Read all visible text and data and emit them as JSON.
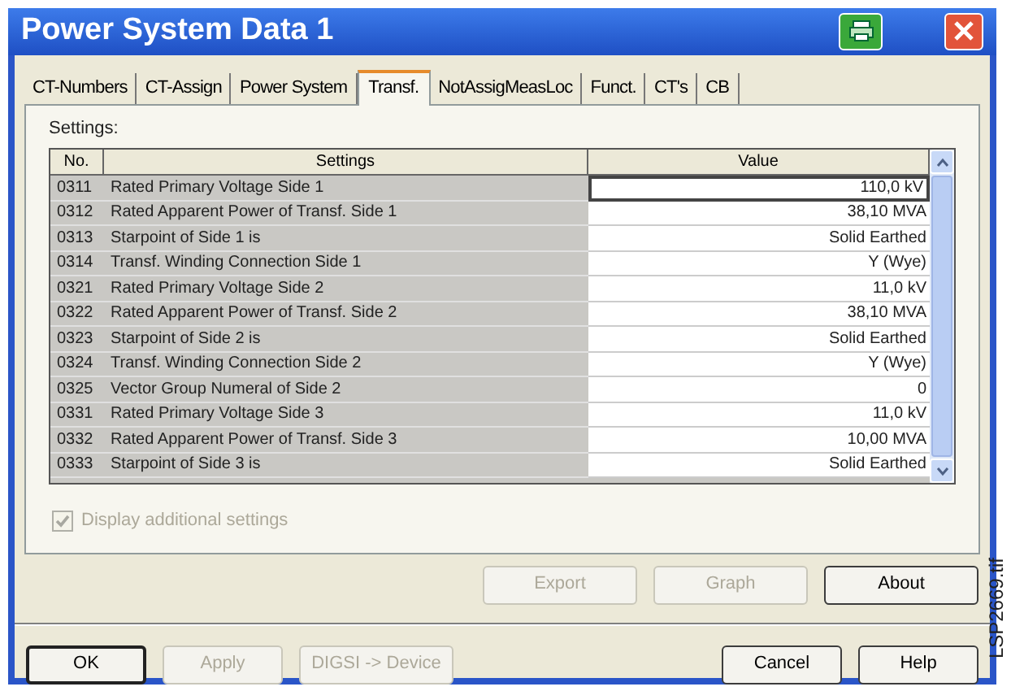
{
  "window": {
    "title": "Power System Data 1"
  },
  "tabs": [
    {
      "label": "CT-Numbers",
      "selected": false
    },
    {
      "label": "CT-Assign",
      "selected": false
    },
    {
      "label": "Power System",
      "selected": false
    },
    {
      "label": "Transf.",
      "selected": true
    },
    {
      "label": "NotAssigMeasLoc",
      "selected": false
    },
    {
      "label": "Funct.",
      "selected": false
    },
    {
      "label": "CT's",
      "selected": false
    },
    {
      "label": "CB",
      "selected": false
    }
  ],
  "settings_label": "Settings:",
  "table": {
    "columns": [
      "No.",
      "Settings",
      "Value"
    ],
    "rows": [
      {
        "no": "0311",
        "setting": "Rated Primary Voltage Side 1",
        "value": "110,0 kV",
        "selected": true
      },
      {
        "no": "0312",
        "setting": "Rated Apparent Power of Transf. Side 1",
        "value": "38,10 MVA",
        "selected": false
      },
      {
        "no": "0313",
        "setting": "Starpoint of Side 1 is",
        "value": "Solid Earthed",
        "selected": false
      },
      {
        "no": "0314",
        "setting": "Transf. Winding Connection Side 1",
        "value": "Y (Wye)",
        "selected": false
      },
      {
        "no": "0321",
        "setting": "Rated Primary Voltage Side 2",
        "value": "11,0 kV",
        "selected": false
      },
      {
        "no": "0322",
        "setting": "Rated Apparent Power of Transf. Side 2",
        "value": "38,10 MVA",
        "selected": false
      },
      {
        "no": "0323",
        "setting": "Starpoint of Side 2 is",
        "value": "Solid Earthed",
        "selected": false
      },
      {
        "no": "0324",
        "setting": "Transf. Winding Connection Side 2",
        "value": "Y (Wye)",
        "selected": false
      },
      {
        "no": "0325",
        "setting": "Vector Group Numeral of Side 2",
        "value": "0",
        "selected": false
      },
      {
        "no": "0331",
        "setting": "Rated Primary Voltage Side 3",
        "value": "11,0 kV",
        "selected": false
      },
      {
        "no": "0332",
        "setting": "Rated Apparent Power of Transf. Side 3",
        "value": "10,00 MVA",
        "selected": false
      },
      {
        "no": "0333",
        "setting": "Starpoint of Side 3 is",
        "value": "Solid Earthed",
        "selected": false
      }
    ]
  },
  "additional_settings": {
    "label": "Display additional settings",
    "checked": true,
    "disabled": true
  },
  "panel_buttons": [
    {
      "label": "Export",
      "disabled": true
    },
    {
      "label": "Graph",
      "disabled": true
    },
    {
      "label": "About",
      "disabled": false
    }
  ],
  "left_buttons": [
    {
      "label": "OK",
      "disabled": false,
      "default": true
    },
    {
      "label": "Apply",
      "disabled": true,
      "default": false
    },
    {
      "label": "DIGSI -> Device",
      "disabled": true,
      "default": false
    }
  ],
  "right_buttons": [
    {
      "label": "Cancel",
      "disabled": false,
      "default": false
    },
    {
      "label": "Help",
      "disabled": false,
      "default": false
    }
  ],
  "figure_id": "LSP2669.tif"
}
